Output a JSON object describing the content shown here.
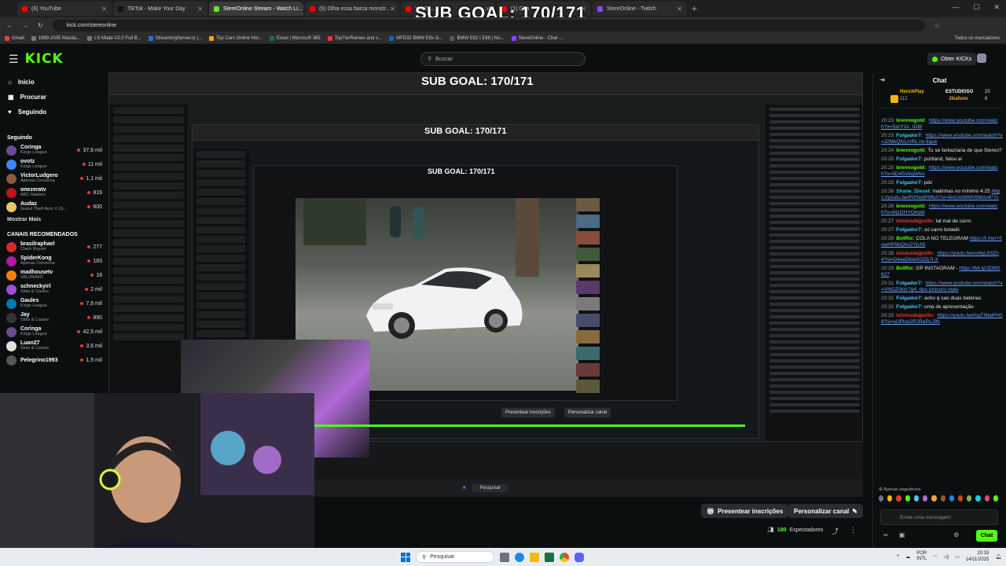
{
  "browser": {
    "tabs": [
      {
        "label": "(6) YouTube",
        "color": "#ff0000"
      },
      {
        "label": "TikTok - Make Your Day",
        "color": "#111111"
      },
      {
        "label": "StereOnline Stream - Watch Li...",
        "color": "#53fc18",
        "active": true
      },
      {
        "label": "(6) Olha essa barca monstr...",
        "color": "#ff0000"
      },
      {
        "label": "YouTu...",
        "color": "#ff0000"
      },
      {
        "label": "(1) Cha",
        "color": "#ff0000"
      },
      {
        "label": "StereOnline - Twitch",
        "color": "#9146ff"
      }
    ],
    "url": "kick.com/stereonline",
    "bookmarks": [
      {
        "label": "Gmail",
        "color": "#ea4335"
      },
      {
        "label": "1989-2005 Mazda...",
        "color": "#777777"
      },
      {
        "label": "LS Miata V2.0 Full B...",
        "color": "#777777"
      },
      {
        "label": "StreamingServer.io |...",
        "color": "#2b6cf6"
      },
      {
        "label": "Top Cars Online Hor...",
        "color": "#f5a623"
      },
      {
        "label": "Excel | Microsoft 365",
        "color": "#1d6f42"
      },
      {
        "label": "TopTierRamen and s...",
        "color": "#e53935"
      },
      {
        "label": "MFD32 BMW E8x G...",
        "color": "#1565c0"
      },
      {
        "label": "BMW E82 | E88 | No...",
        "color": "#555555"
      },
      {
        "label": "StereOnline - Chat -...",
        "color": "#9146ff"
      }
    ],
    "all_bookmarks": "Todos os marcadores"
  },
  "overlay": {
    "sub_goal": "SUB GOAL: 170/171"
  },
  "kick": {
    "logo": "KICK",
    "search_placeholder": "Buscar",
    "obter_kicks": "Obter KICKs",
    "nav": {
      "inicio": "Início",
      "procurar": "Procurar",
      "seguindo": "Seguindo"
    },
    "following_title": "Seguindo",
    "following": [
      {
        "name": "Coringa",
        "game": "Kings League",
        "viewers": "37,6 mil",
        "color": "#6a4c93"
      },
      {
        "name": "ovotz",
        "game": "Kings League",
        "viewers": "11 mil",
        "color": "#3a86ff"
      },
      {
        "name": "VictorLudgero",
        "game": "Apenas Conversa",
        "viewers": "1,1 mil",
        "color": "#8d5a3b"
      },
      {
        "name": "onezeratv",
        "game": "ARC Raiders",
        "viewers": "819",
        "color": "#c1121f"
      },
      {
        "name": "Audaz",
        "game": "Grand Theft Auto V (G...",
        "viewers": "600",
        "color": "#e9c46a"
      }
    ],
    "show_more": "Mostrar Mais",
    "recommended_title": "CANAIS RECOMENDADOS",
    "recommended": [
      {
        "name": "brasilraphael",
        "game": "Clash Royale",
        "viewers": "277",
        "color": "#d62828"
      },
      {
        "name": "SpiderKong",
        "game": "Apenas Conversa",
        "viewers": "183",
        "color": "#b5179e"
      },
      {
        "name": "madhousetv",
        "game": "VALORANT",
        "viewers": "18",
        "color": "#f77f00"
      },
      {
        "name": "schneckyirl",
        "game": "Slots & Casino",
        "viewers": "2 mil",
        "color": "#9d4edd"
      },
      {
        "name": "Gaules",
        "game": "Kings League",
        "viewers": "7,6 mil",
        "color": "#0077b6"
      },
      {
        "name": "Jay",
        "game": "Slots & Casino",
        "viewers": "890",
        "color": "#333333"
      },
      {
        "name": "Coringa",
        "game": "Kings League",
        "viewers": "42,5 mil",
        "color": "#6a4c93"
      },
      {
        "name": "Luan27",
        "game": "Slots & Casino",
        "viewers": "3,6 mil",
        "color": "#e0e0e0"
      },
      {
        "name": "Pelegrino1993",
        "game": "",
        "viewers": "1,5 mil",
        "color": "#555555"
      }
    ],
    "present_subs": "Presentear inscrições",
    "customize": "Personalizar canal",
    "viewers_count": "180",
    "viewers_label": "Espectadores"
  },
  "chat": {
    "title": "Chat",
    "pinned_user": "HerickPlay",
    "pinned_count": "112",
    "pinned_badge1": "ESTUDIOSO",
    "pinned_badge1_count": "20",
    "pinned_badge2": "Jikafunn",
    "pinned_badge2_count": "6",
    "messages": [
      {
        "time": "20:23",
        "user": "brennogold:",
        "color": "#53fc18",
        "text": "",
        "link": "https://www.youtube.com/watch?v=SorY2o_rl2M"
      },
      {
        "time": "20:23",
        "user": "Folgador7:",
        "color": "#4fc3f7",
        "text": "",
        "link": "https://www.youtube.com/watch?v=J2MkQfvLmRs no tique"
      },
      {
        "time": "20:24",
        "user": "brennogold:",
        "color": "#53fc18",
        "text": "Tu se fantazíaria de que Stereo?",
        "link": ""
      },
      {
        "time": "20:25",
        "user": "Folgador7:",
        "color": "#4fc3f7",
        "text": "portland, falou ai",
        "link": ""
      },
      {
        "time": "20:25",
        "user": "brennogold:",
        "color": "#53fc18",
        "text": "",
        "link": "https://www.youtube.com/watch?v=5D4SVkqWtro"
      },
      {
        "time": "20:25",
        "user": "Folgador7:",
        "color": "#4fc3f7",
        "text": "pdc",
        "link": ""
      },
      {
        "time": "20:26",
        "user": "Shane_Diesel:",
        "color": "#26c6da",
        "text": "matinhas no mínimo 4:25",
        "link": "https://youtu.be/PlXNdiP9fbA?si=6mUolWMV8MAn6*7c"
      },
      {
        "time": "20:26",
        "user": "brennogold:",
        "color": "#53fc18",
        "text": "",
        "link": "https://www.youtube.com/watch?v=iNzGHYOmd4"
      },
      {
        "time": "20:27",
        "user": "lololosdejpolfo:",
        "color": "#e53935",
        "text": "tal mal de carro",
        "link": ""
      },
      {
        "time": "20:27",
        "user": "Folgador7:",
        "color": "#4fc3f7",
        "text": "só carro boladó",
        "link": ""
      },
      {
        "time": "20:28",
        "user": "BotRix:",
        "color": "#53fc18",
        "text": "COLA NO TELEGRAM",
        "link": "https://t.me/+5owHP5bQho2YjUI5"
      },
      {
        "time": "20:28",
        "user": "lololosdejpolfo:",
        "color": "#e53935",
        "text": "",
        "link": "https://youtu.be/vx6yLlISZn4?si=D4eeDbwSOZb7l-X"
      },
      {
        "time": "20:29",
        "user": "BotRix:",
        "color": "#53fc18",
        "text": "GP INSTAGRAM -",
        "link": "https://bit.ly/3DM2827"
      },
      {
        "time": "20:31",
        "user": "Folgador7:",
        "color": "#4fc3f7",
        "text": "",
        "link": "https://www.youtube.com/watch?v=VNGZ0kzr7g4, dps procuro mais"
      },
      {
        "time": "20:32",
        "user": "Folgador7:",
        "color": "#4fc3f7",
        "text": "acho q sao duas baterias",
        "link": ""
      },
      {
        "time": "20:32",
        "user": "Folgador7:",
        "color": "#4fc3f7",
        "text": "uma de apresentação",
        "link": ""
      },
      {
        "time": "20:33",
        "user": "lololosdejpolfo:",
        "color": "#e53935",
        "text": "",
        "link": "https://youtu.be/foqTNtwPH08?si=sUPloo2RJRaPuJ9h"
      }
    ],
    "followers_only": "Apenas seguidores",
    "input_placeholder": "Envie uma mensagem",
    "send": "Chat"
  },
  "taskbar": {
    "search": "Pesquisar",
    "lang": "POR",
    "lang2": "INTL",
    "time": "20:33",
    "date": "14/11/2025"
  }
}
